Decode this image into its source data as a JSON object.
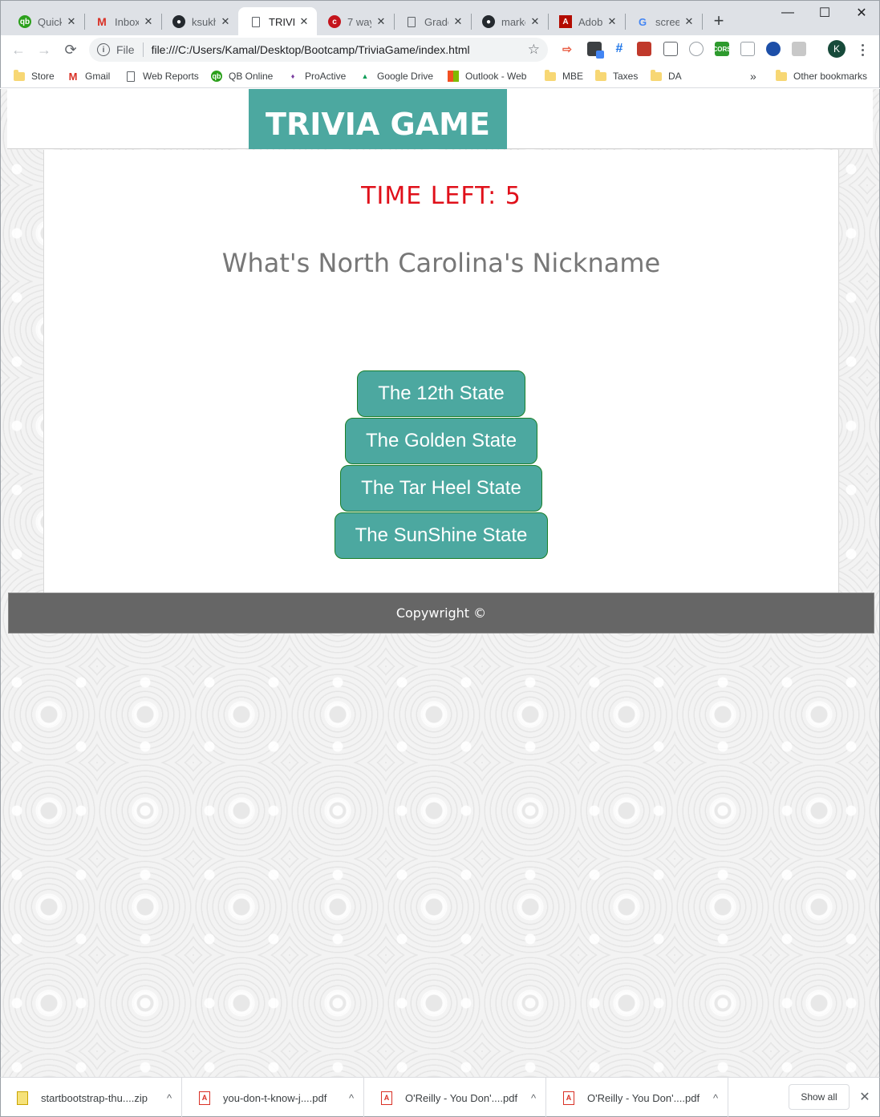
{
  "browser": {
    "tabs": [
      {
        "title": "Quick",
        "icon": "quickbooks-icon",
        "active": false
      },
      {
        "title": "Inbox",
        "icon": "gmail-icon",
        "active": false
      },
      {
        "title": "ksukh",
        "icon": "github-icon",
        "active": false
      },
      {
        "title": "TRIVIA",
        "icon": "page-icon",
        "active": true
      },
      {
        "title": "7 way",
        "icon": "red-circle-icon",
        "active": false
      },
      {
        "title": "Grade",
        "icon": "page-icon",
        "active": false
      },
      {
        "title": "marko",
        "icon": "github-icon",
        "active": false
      },
      {
        "title": "Adobe",
        "icon": "adobe-icon",
        "active": false
      },
      {
        "title": "screen",
        "icon": "google-icon",
        "active": false
      }
    ],
    "address": {
      "scheme": "File",
      "url": "file:///C:/Users/Kamal/Desktop/Bootcamp/TriviaGame/index.html"
    },
    "profile_initial": "K",
    "bookmarks": [
      {
        "label": "Store",
        "icon": "folder-icon"
      },
      {
        "label": "Gmail",
        "icon": "gmail-icon"
      },
      {
        "label": "Web Reports",
        "icon": "page-icon"
      },
      {
        "label": "QB Online",
        "icon": "quickbooks-icon"
      },
      {
        "label": "ProActive",
        "icon": "proactive-icon"
      },
      {
        "label": "Google Drive",
        "icon": "drive-icon"
      },
      {
        "label": "Outlook - Web",
        "icon": "office-icon"
      },
      {
        "label": "MBE",
        "icon": "folder-icon"
      },
      {
        "label": "Taxes",
        "icon": "folder-icon"
      },
      {
        "label": "DA",
        "icon": "folder-icon"
      }
    ],
    "bookmarks_overflow": "»",
    "other_bookmarks": "Other bookmarks"
  },
  "page": {
    "brand": "TRIVIA GAME",
    "timer": "TIME LEFT: 5",
    "question": "What's North Carolina's Nickname",
    "answers": [
      "The 12th State",
      "The Golden State",
      "The Tar Heel State",
      "The SunShine State"
    ],
    "footer": "Copywright ©"
  },
  "downloads": {
    "items": [
      {
        "name": "startbootstrap-thu....zip",
        "icon": "zip-icon"
      },
      {
        "name": "you-don-t-know-j....pdf",
        "icon": "pdf-icon"
      },
      {
        "name": "O'Reilly - You Don'....pdf",
        "icon": "pdf-icon"
      },
      {
        "name": "O'Reilly - You Don'....pdf",
        "icon": "pdf-icon"
      }
    ],
    "show_all": "Show all"
  },
  "colors": {
    "brand": "#4ca8a0",
    "timer": "#e0101a",
    "footer": "#666666",
    "button_border": "#1a7f2a"
  }
}
